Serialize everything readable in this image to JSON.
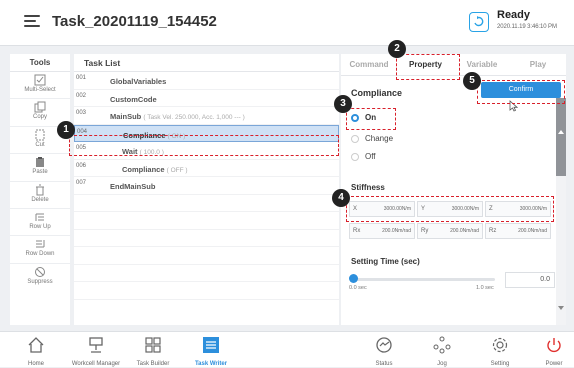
{
  "header": {
    "title": "Task_20201119_154452",
    "status": "Ready",
    "status_time": "2020.11.19 3:46:10 PM"
  },
  "tools": {
    "title": "Tools",
    "items": [
      {
        "label": "Multi-Select",
        "icon": "multi-select-icon"
      },
      {
        "label": "Copy",
        "icon": "copy-icon"
      },
      {
        "label": "Cut",
        "icon": "cut-icon"
      },
      {
        "label": "Paste",
        "icon": "paste-icon"
      },
      {
        "label": "Delete",
        "icon": "trash-icon"
      },
      {
        "label": "Row Up",
        "icon": "row-up-icon"
      },
      {
        "label": "Row Down",
        "icon": "row-down-icon"
      },
      {
        "label": "Suppress",
        "icon": "suppress-icon"
      }
    ]
  },
  "task_list": {
    "title": "Task List",
    "rows": [
      {
        "num": "001",
        "text": "GlobalVariables",
        "detail": ""
      },
      {
        "num": "002",
        "text": "CustomCode",
        "detail": ""
      },
      {
        "num": "003",
        "text": "MainSub",
        "detail": "( Task Vel. 250.000, Acc. 1,000 --- )"
      },
      {
        "num": "004",
        "text": "Compliance",
        "detail": "( ON )"
      },
      {
        "num": "005",
        "text": "Wait",
        "detail": "( 100.0 )"
      },
      {
        "num": "006",
        "text": "Compliance",
        "detail": "( OFF )"
      },
      {
        "num": "007",
        "text": "EndMainSub",
        "detail": ""
      }
    ]
  },
  "panel": {
    "tabs": [
      "Command",
      "Property",
      "Variable",
      "Play"
    ],
    "active_tab": "Property",
    "section": "Compliance",
    "confirm_label": "Confirm",
    "options": [
      "On",
      "Change",
      "Off"
    ],
    "selected_option": "On",
    "stiffness": {
      "title": "Stiffness",
      "x": {
        "label": "X",
        "value": "3000.00N/m"
      },
      "y": {
        "label": "Y",
        "value": "3000.00N/m"
      },
      "z": {
        "label": "Z",
        "value": "3000.00N/m"
      },
      "rx": {
        "label": "Rx",
        "value": "200.0Nm/rad"
      },
      "ry": {
        "label": "Ry",
        "value": "200.0Nm/rad"
      },
      "rz": {
        "label": "Rz",
        "value": "200.0Nm/rad"
      }
    },
    "setting_time": {
      "title": "Setting Time (sec)",
      "min_label": "0.0 sec",
      "max_label": "1.0 sec",
      "value": "0.0",
      "fraction": 0.0
    }
  },
  "bottom_nav": [
    {
      "label": "Home",
      "icon": "home-icon"
    },
    {
      "label": "Workcell Manager",
      "icon": "workcell-icon"
    },
    {
      "label": "Task Builder",
      "icon": "task-builder-icon"
    },
    {
      "label": "Task Writer",
      "icon": "task-writer-icon"
    },
    {
      "label": "Status",
      "icon": "status-icon"
    },
    {
      "label": "Jog",
      "icon": "jog-icon"
    },
    {
      "label": "Setting",
      "icon": "gear-icon"
    },
    {
      "label": "Power",
      "icon": "power-icon"
    }
  ],
  "callouts": [
    "1",
    "2",
    "3",
    "4",
    "5"
  ],
  "colors": {
    "accent": "#2d8fdc",
    "highlight": "#d8202b",
    "power": "#e0302e"
  }
}
